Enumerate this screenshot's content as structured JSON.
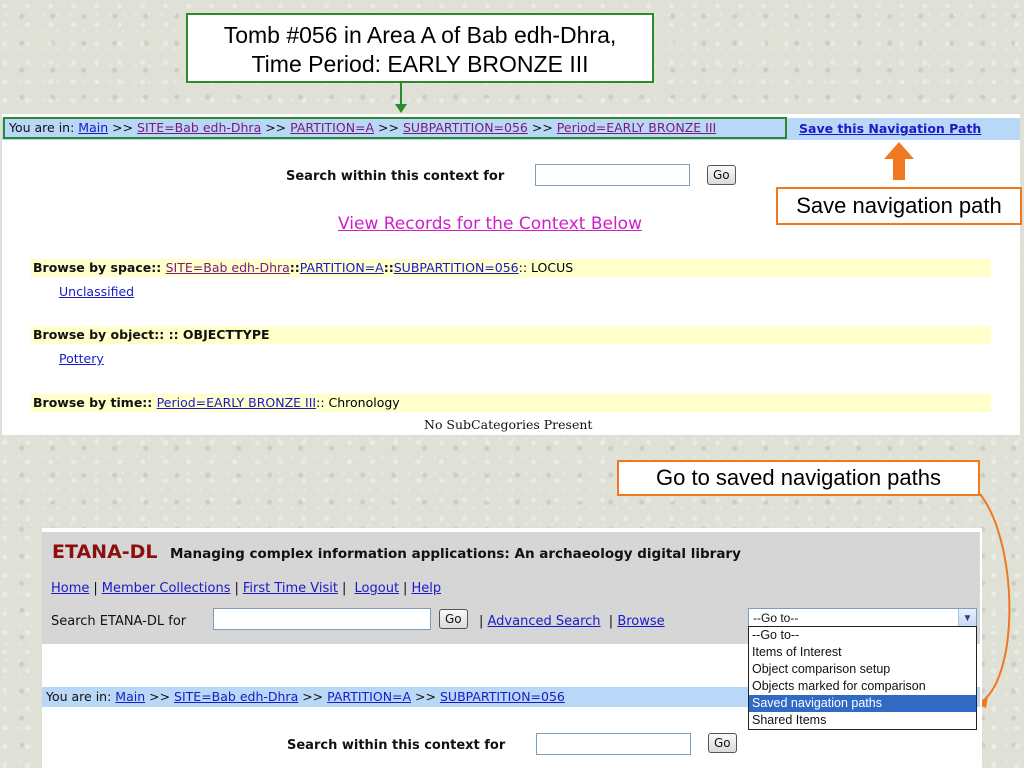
{
  "callouts": {
    "tomb_line1": "Tomb #056 in Area A of Bab edh-Dhra,",
    "tomb_line2": "Time Period: EARLY BRONZE III",
    "save_path": "Save navigation path",
    "goto_saved": "Go to saved navigation paths"
  },
  "upper": {
    "breadcrumb": {
      "prefix": "You are in: ",
      "items": [
        "Main",
        "SITE=Bab edh-Dhra",
        "PARTITION=A",
        "SUBPARTITION=056",
        "Period=EARLY BRONZE III"
      ],
      "sep": " >> "
    },
    "save_link": "Save this Navigation Path",
    "search_label": "Search within this context for",
    "search_value": "",
    "go_label": "Go",
    "view_records": "View Records for the Context Below",
    "browse_space": {
      "label": "Browse by space:: ",
      "links": [
        "SITE=Bab edh-Dhra",
        "PARTITION=A",
        "SUBPARTITION=056"
      ],
      "tail": ":: LOCUS",
      "sub": "Unclassified"
    },
    "browse_object": {
      "label": "Browse by object:: :: OBJECTTYPE",
      "sub": "Pottery"
    },
    "browse_time": {
      "label": "Browse by time:: ",
      "link": "Period=EARLY BRONZE III",
      "tail": ":: Chronology"
    },
    "no_sub": "No SubCategories Present"
  },
  "lower": {
    "brand": "ETANA-DL",
    "tagline": "Managing complex information applications:  An archaeology digital library",
    "nav": [
      "Home",
      "Member Collections",
      "First Time Visit",
      "Logout",
      "Help"
    ],
    "search_label": "Search ETANA-DL for",
    "search_value": "",
    "go_label": "Go",
    "advanced_search": "Advanced Search",
    "browse": "Browse",
    "select_value": "--Go to--",
    "dropdown_options": [
      "--Go to--",
      "Items of Interest",
      "Object comparison setup",
      "Objects marked for comparison",
      "Saved navigation paths",
      "Shared Items"
    ],
    "dropdown_selected_index": 4,
    "breadcrumb": {
      "prefix": "You are in: ",
      "items": [
        "Main",
        "SITE=Bab edh-Dhra",
        "PARTITION=A",
        "SUBPARTITION=056"
      ],
      "sep": " >> "
    },
    "ctx_search_label": "Search within this context for",
    "ctx_search_value": "",
    "ctx_go_label": "Go"
  },
  "colors": {
    "callout_green": "#2c8a2c",
    "callout_orange": "#f07820",
    "breadcrumb_bar": "#b9d7f7",
    "browse_row": "#ffffcc",
    "brand_red": "#8b0f0f",
    "select_highlight": "#316ac5"
  }
}
